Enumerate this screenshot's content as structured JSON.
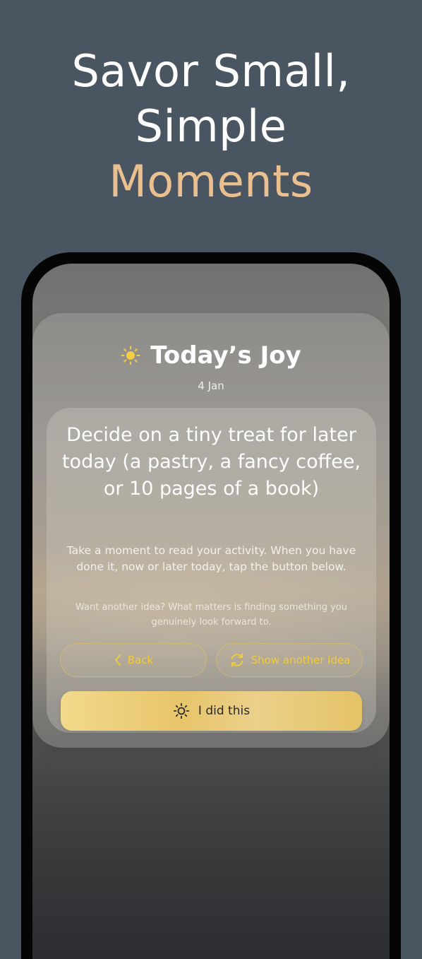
{
  "headline": {
    "line1": "Savor Small,",
    "line2": "Simple",
    "line3": "Moments",
    "accent_color": "#ebc08f"
  },
  "app": {
    "title": "Today’s Joy",
    "title_icon": "sun-icon",
    "date": "4 Jan",
    "activity": "Decide on a tiny treat for later today (a pastry, a fancy coffee, or 10 pages of a book)",
    "instructions": "Take a moment to read your activity. When you have done it, now or later today, tap the button below.",
    "hint": "Want another idea? What matters is finding something you genuinely look forward to.",
    "back_button": {
      "label": "Back",
      "icon": "chevron-left-icon"
    },
    "another_button": {
      "label": "Show another idea",
      "icon": "refresh-icon"
    },
    "done_button": {
      "label": "I did this",
      "icon": "sun-outline-icon"
    },
    "accent_color": "#f1cb3a"
  }
}
